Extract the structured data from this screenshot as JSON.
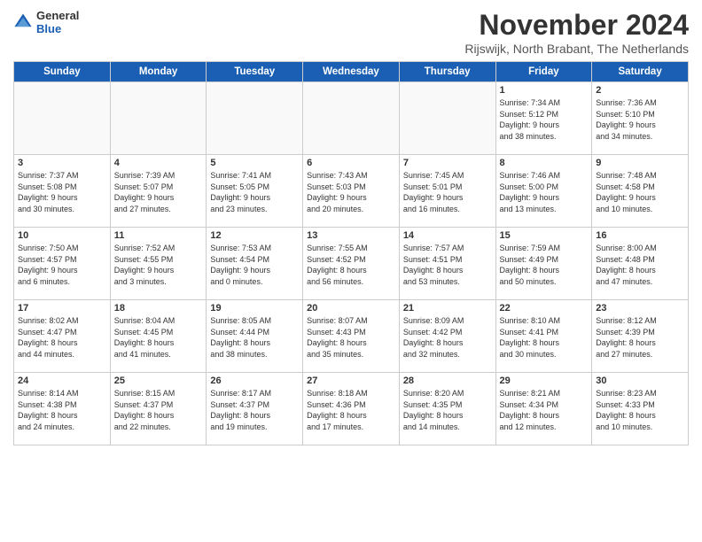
{
  "header": {
    "logo_general": "General",
    "logo_blue": "Blue",
    "month_title": "November 2024",
    "location": "Rijswijk, North Brabant, The Netherlands"
  },
  "columns": [
    "Sunday",
    "Monday",
    "Tuesday",
    "Wednesday",
    "Thursday",
    "Friday",
    "Saturday"
  ],
  "weeks": [
    {
      "days": [
        {
          "num": "",
          "detail": "",
          "empty": true
        },
        {
          "num": "",
          "detail": "",
          "empty": true
        },
        {
          "num": "",
          "detail": "",
          "empty": true
        },
        {
          "num": "",
          "detail": "",
          "empty": true
        },
        {
          "num": "",
          "detail": "",
          "empty": true
        },
        {
          "num": "1",
          "detail": "Sunrise: 7:34 AM\nSunset: 5:12 PM\nDaylight: 9 hours\nand 38 minutes."
        },
        {
          "num": "2",
          "detail": "Sunrise: 7:36 AM\nSunset: 5:10 PM\nDaylight: 9 hours\nand 34 minutes."
        }
      ]
    },
    {
      "days": [
        {
          "num": "3",
          "detail": "Sunrise: 7:37 AM\nSunset: 5:08 PM\nDaylight: 9 hours\nand 30 minutes."
        },
        {
          "num": "4",
          "detail": "Sunrise: 7:39 AM\nSunset: 5:07 PM\nDaylight: 9 hours\nand 27 minutes."
        },
        {
          "num": "5",
          "detail": "Sunrise: 7:41 AM\nSunset: 5:05 PM\nDaylight: 9 hours\nand 23 minutes."
        },
        {
          "num": "6",
          "detail": "Sunrise: 7:43 AM\nSunset: 5:03 PM\nDaylight: 9 hours\nand 20 minutes."
        },
        {
          "num": "7",
          "detail": "Sunrise: 7:45 AM\nSunset: 5:01 PM\nDaylight: 9 hours\nand 16 minutes."
        },
        {
          "num": "8",
          "detail": "Sunrise: 7:46 AM\nSunset: 5:00 PM\nDaylight: 9 hours\nand 13 minutes."
        },
        {
          "num": "9",
          "detail": "Sunrise: 7:48 AM\nSunset: 4:58 PM\nDaylight: 9 hours\nand 10 minutes."
        }
      ]
    },
    {
      "days": [
        {
          "num": "10",
          "detail": "Sunrise: 7:50 AM\nSunset: 4:57 PM\nDaylight: 9 hours\nand 6 minutes."
        },
        {
          "num": "11",
          "detail": "Sunrise: 7:52 AM\nSunset: 4:55 PM\nDaylight: 9 hours\nand 3 minutes."
        },
        {
          "num": "12",
          "detail": "Sunrise: 7:53 AM\nSunset: 4:54 PM\nDaylight: 9 hours\nand 0 minutes."
        },
        {
          "num": "13",
          "detail": "Sunrise: 7:55 AM\nSunset: 4:52 PM\nDaylight: 8 hours\nand 56 minutes."
        },
        {
          "num": "14",
          "detail": "Sunrise: 7:57 AM\nSunset: 4:51 PM\nDaylight: 8 hours\nand 53 minutes."
        },
        {
          "num": "15",
          "detail": "Sunrise: 7:59 AM\nSunset: 4:49 PM\nDaylight: 8 hours\nand 50 minutes."
        },
        {
          "num": "16",
          "detail": "Sunrise: 8:00 AM\nSunset: 4:48 PM\nDaylight: 8 hours\nand 47 minutes."
        }
      ]
    },
    {
      "days": [
        {
          "num": "17",
          "detail": "Sunrise: 8:02 AM\nSunset: 4:47 PM\nDaylight: 8 hours\nand 44 minutes."
        },
        {
          "num": "18",
          "detail": "Sunrise: 8:04 AM\nSunset: 4:45 PM\nDaylight: 8 hours\nand 41 minutes."
        },
        {
          "num": "19",
          "detail": "Sunrise: 8:05 AM\nSunset: 4:44 PM\nDaylight: 8 hours\nand 38 minutes."
        },
        {
          "num": "20",
          "detail": "Sunrise: 8:07 AM\nSunset: 4:43 PM\nDaylight: 8 hours\nand 35 minutes."
        },
        {
          "num": "21",
          "detail": "Sunrise: 8:09 AM\nSunset: 4:42 PM\nDaylight: 8 hours\nand 32 minutes."
        },
        {
          "num": "22",
          "detail": "Sunrise: 8:10 AM\nSunset: 4:41 PM\nDaylight: 8 hours\nand 30 minutes."
        },
        {
          "num": "23",
          "detail": "Sunrise: 8:12 AM\nSunset: 4:39 PM\nDaylight: 8 hours\nand 27 minutes."
        }
      ]
    },
    {
      "days": [
        {
          "num": "24",
          "detail": "Sunrise: 8:14 AM\nSunset: 4:38 PM\nDaylight: 8 hours\nand 24 minutes."
        },
        {
          "num": "25",
          "detail": "Sunrise: 8:15 AM\nSunset: 4:37 PM\nDaylight: 8 hours\nand 22 minutes."
        },
        {
          "num": "26",
          "detail": "Sunrise: 8:17 AM\nSunset: 4:37 PM\nDaylight: 8 hours\nand 19 minutes."
        },
        {
          "num": "27",
          "detail": "Sunrise: 8:18 AM\nSunset: 4:36 PM\nDaylight: 8 hours\nand 17 minutes."
        },
        {
          "num": "28",
          "detail": "Sunrise: 8:20 AM\nSunset: 4:35 PM\nDaylight: 8 hours\nand 14 minutes."
        },
        {
          "num": "29",
          "detail": "Sunrise: 8:21 AM\nSunset: 4:34 PM\nDaylight: 8 hours\nand 12 minutes."
        },
        {
          "num": "30",
          "detail": "Sunrise: 8:23 AM\nSunset: 4:33 PM\nDaylight: 8 hours\nand 10 minutes."
        }
      ]
    }
  ]
}
